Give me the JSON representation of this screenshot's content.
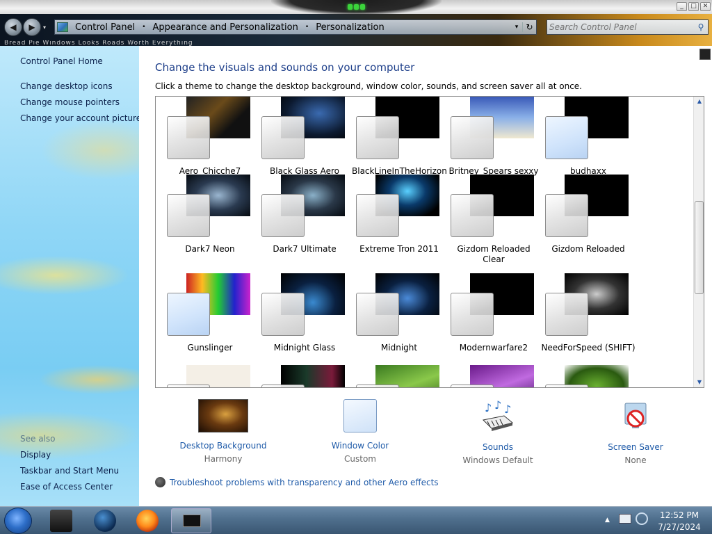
{
  "window": {
    "minimize_symbol": "_",
    "maximize_symbol": "□",
    "close_symbol": "✕"
  },
  "nav": {
    "back_symbol": "◀",
    "forward_symbol": "▶",
    "history_symbol": "▾"
  },
  "address": {
    "crumbs": [
      "Control Panel",
      "Appearance and Personalization",
      "Personalization"
    ],
    "separator": "•",
    "dropdown_symbol": "▾",
    "refresh_symbol": "↻"
  },
  "search": {
    "placeholder": "Search Control Panel",
    "icon": "search-icon",
    "icon_symbol": "⚲"
  },
  "bookmarks_strip": "Bread Pie Windows Looks Roads Worth Everything",
  "sidebar": {
    "home": "Control Panel Home",
    "links": [
      "Change desktop icons",
      "Change mouse pointers",
      "Change your account picture"
    ],
    "see_also_label": "See also",
    "see_also": [
      "Display",
      "Taskbar and Start Menu",
      "Ease of Access Center"
    ]
  },
  "main": {
    "title": "Change the visuals and sounds on your computer",
    "description": "Click a theme to change the desktop background, window color, sounds, and screen saver all at once.",
    "themes": [
      {
        "label": "Aero_Chicche7"
      },
      {
        "label": "Black Glass Aero"
      },
      {
        "label": "BlackLineInTheHorizon"
      },
      {
        "label": "Britney_Spears sexxy"
      },
      {
        "label": "budhaxx"
      },
      {
        "label": "Dark7 Neon"
      },
      {
        "label": "Dark7 Ultimate"
      },
      {
        "label": "Extreme Tron 2011"
      },
      {
        "label": "Gizdom Reloaded Clear"
      },
      {
        "label": "Gizdom Reloaded"
      },
      {
        "label": "Gunslinger"
      },
      {
        "label": "Midnight Glass"
      },
      {
        "label": "Midnight"
      },
      {
        "label": "Modernwarfare2"
      },
      {
        "label": "NeedForSpeed (SHIFT)"
      },
      {
        "label": ""
      },
      {
        "label": ""
      },
      {
        "label": ""
      },
      {
        "label": ""
      },
      {
        "label": ""
      }
    ],
    "scroll": {
      "up_symbol": "▲",
      "down_symbol": "▼"
    },
    "bottom": [
      {
        "title": "Desktop Background",
        "sub": "Harmony",
        "icon": "desktop-background-icon"
      },
      {
        "title": "Window Color",
        "sub": "Custom",
        "icon": "window-color-icon"
      },
      {
        "title": "Sounds",
        "sub": "Windows Default",
        "icon": "sounds-icon"
      },
      {
        "title": "Screen Saver",
        "sub": "None",
        "icon": "screen-saver-icon"
      }
    ],
    "troubleshoot": "Troubleshoot problems with transparency and other Aero effects"
  },
  "taskbar": {
    "time": "12:52 PM",
    "date": "7/27/2024",
    "tray_expand_symbol": "▲"
  }
}
